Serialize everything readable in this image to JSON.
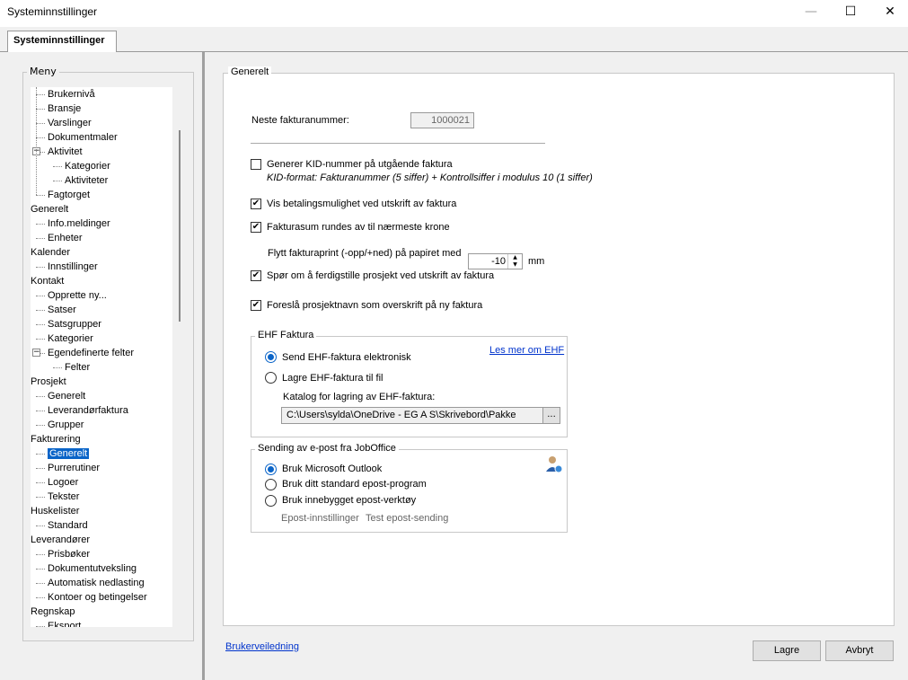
{
  "window": {
    "title": "Systeminnstillinger"
  },
  "tab": {
    "label": "Systeminnstillinger"
  },
  "menu": {
    "legend": "Meny",
    "items": [
      {
        "label": "Brukernivå",
        "level": 1
      },
      {
        "label": "Bransje",
        "level": 1
      },
      {
        "label": "Varslinger",
        "level": 1
      },
      {
        "label": "Dokumentmaler",
        "level": 1
      },
      {
        "label": "Aktivitet",
        "level": 1,
        "expander": "⊟"
      },
      {
        "label": "Kategorier",
        "level": 2
      },
      {
        "label": "Aktiviteter",
        "level": 2
      },
      {
        "label": "Fagtorget",
        "level": 1
      },
      {
        "label": "Generelt",
        "level": 0
      },
      {
        "label": "Info.meldinger",
        "level": 1
      },
      {
        "label": "Enheter",
        "level": 1
      },
      {
        "label": "Kalender",
        "level": 0
      },
      {
        "label": "Innstillinger",
        "level": 1
      },
      {
        "label": "Kontakt",
        "level": 0
      },
      {
        "label": "Opprette ny...",
        "level": 1
      },
      {
        "label": "Satser",
        "level": 1
      },
      {
        "label": "Satsgrupper",
        "level": 1
      },
      {
        "label": "Kategorier",
        "level": 1
      },
      {
        "label": "Egendefinerte felter",
        "level": 1,
        "expander": "⊟"
      },
      {
        "label": "Felter",
        "level": 2
      },
      {
        "label": "Prosjekt",
        "level": 0
      },
      {
        "label": "Generelt",
        "level": 1
      },
      {
        "label": "Leverandørfaktura",
        "level": 1
      },
      {
        "label": "Grupper",
        "level": 1
      },
      {
        "label": "Fakturering",
        "level": 0
      },
      {
        "label": "Generelt",
        "level": 1,
        "selected": true
      },
      {
        "label": "Purrerutiner",
        "level": 1
      },
      {
        "label": "Logoer",
        "level": 1
      },
      {
        "label": "Tekster",
        "level": 1
      },
      {
        "label": "Huskelister",
        "level": 0
      },
      {
        "label": "Standard",
        "level": 1
      },
      {
        "label": "Leverandører",
        "level": 0
      },
      {
        "label": "Prisbøker",
        "level": 1
      },
      {
        "label": "Dokumentutveksling",
        "level": 1
      },
      {
        "label": "Automatisk nedlasting",
        "level": 1
      },
      {
        "label": "Kontoer og betingelser",
        "level": 1
      },
      {
        "label": "Regnskap",
        "level": 0
      },
      {
        "label": "Eksport",
        "level": 1
      }
    ]
  },
  "general": {
    "legend": "Generelt",
    "next_invoice_label": "Neste fakturanummer:",
    "next_invoice_value": "1000021",
    "kid_label": "Generer KID-nummer på utgående faktura",
    "kid_format": "KID-format: Fakturanummer (5 siffer) + Kontrollsiffer i modulus 10 (1 siffer)",
    "kid_checked": false,
    "payment_label": "Vis betalingsmulighet ved utskrift av faktura",
    "payment_checked": true,
    "rounding_label": "Fakturasum rundes av til nærmeste krone",
    "rounding_checked": true,
    "offset_label": "Flytt fakturaprint (-opp/+ned) på papiret med",
    "offset_value": "-10",
    "offset_unit": "mm",
    "finish_project_label": "Spør om å ferdigstille prosjekt ved utskrift av faktura",
    "finish_project_checked": true,
    "suggest_name_label": "Foreslå prosjektnavn som overskrift på ny faktura",
    "suggest_name_checked": true
  },
  "ehf": {
    "legend": "EHF Faktura",
    "learn_more": "Les mer om EHF",
    "send_label": "Send EHF-faktura elektronisk",
    "save_label": "Lagre EHF-faktura til fil",
    "selected": "send",
    "folder_label": "Katalog for lagring av EHF-faktura:",
    "folder_value": "C:\\Users\\sylda\\OneDrive - EG A S\\Skrivebord\\Pakke",
    "browse_label": "..."
  },
  "mail": {
    "legend": "Sending av e-post fra JobOffice",
    "outlook_label": "Bruk Microsoft Outlook",
    "default_label": "Bruk ditt standard epost-program",
    "builtin_label": "Bruk innebygget epost-verktøy",
    "selected": "outlook",
    "settings_link": "Epost-innstillinger",
    "test_link": "Test epost-sending"
  },
  "footer": {
    "help_link": "Brukerveiledning",
    "save_button": "Lagre",
    "cancel_button": "Avbryt"
  },
  "colors": {
    "accent": "#0a64c8",
    "link": "#0033cc"
  }
}
